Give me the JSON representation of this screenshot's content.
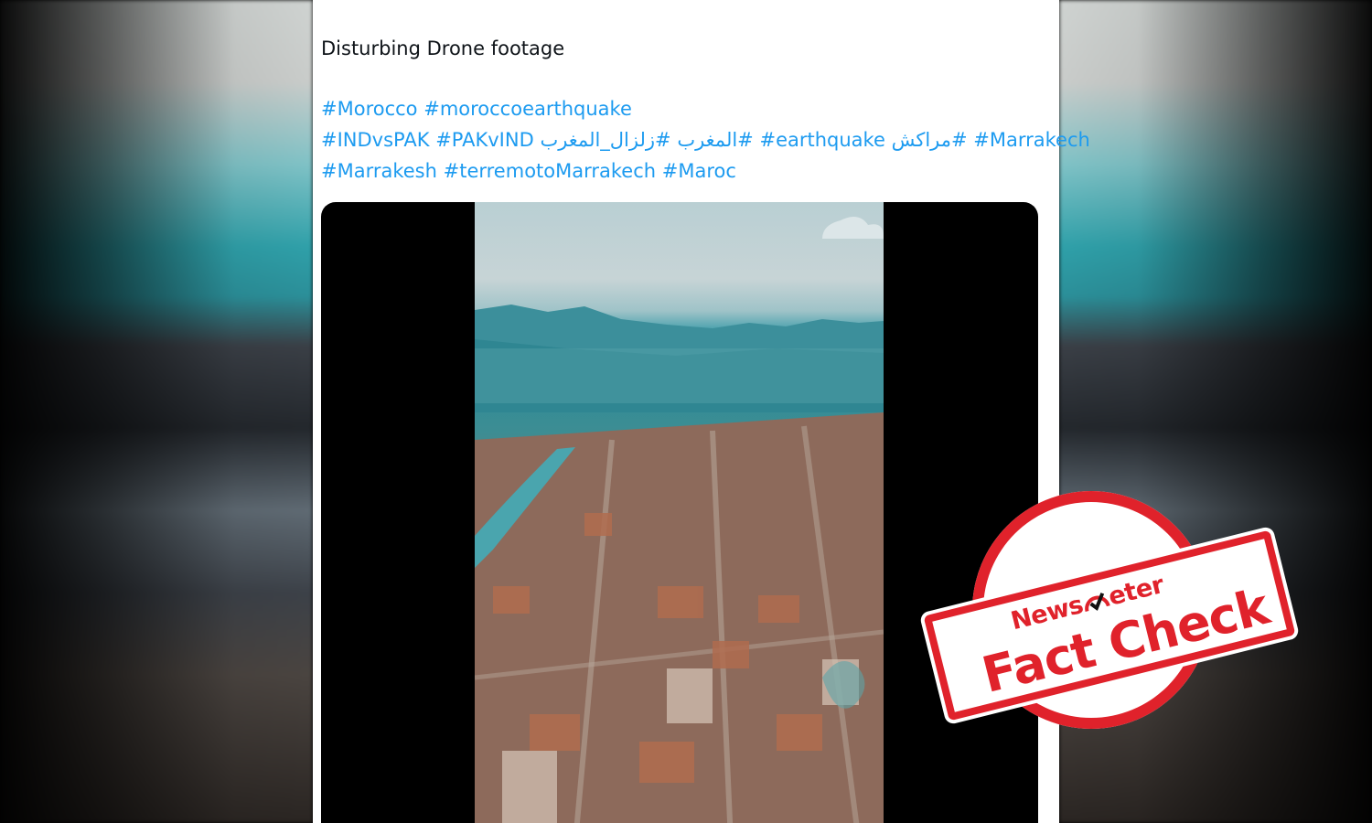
{
  "tweet": {
    "text_line1": "Disturbing Drone footage",
    "hashtag_lines": [
      [
        "#Morocco",
        "#moroccoearthquake"
      ],
      [
        "#INDvsPAK",
        "#PAKvIND",
        "#زلزال_المغرب",
        "#المغرب",
        "#مراكش",
        "#earthquake",
        "#Marrakech"
      ],
      [
        "#Marrakesh",
        "#terremotoMarrakech",
        "#Maroc"
      ]
    ],
    "hashtag_line2_ltr_order": [
      "#INDvsPAK",
      "#PAKvIND",
      "زلزال_المغرب#",
      "المغرب#",
      "#earthquake",
      "مراكش#",
      "#Marrakech"
    ],
    "link_color": "#1d9bf0"
  },
  "media": {
    "type": "video",
    "description_icon": "aerial-city-video"
  },
  "stamp": {
    "brand_part1": "News",
    "brand_part2": "eter",
    "label": "Fact Check",
    "color": "#e0222b"
  }
}
